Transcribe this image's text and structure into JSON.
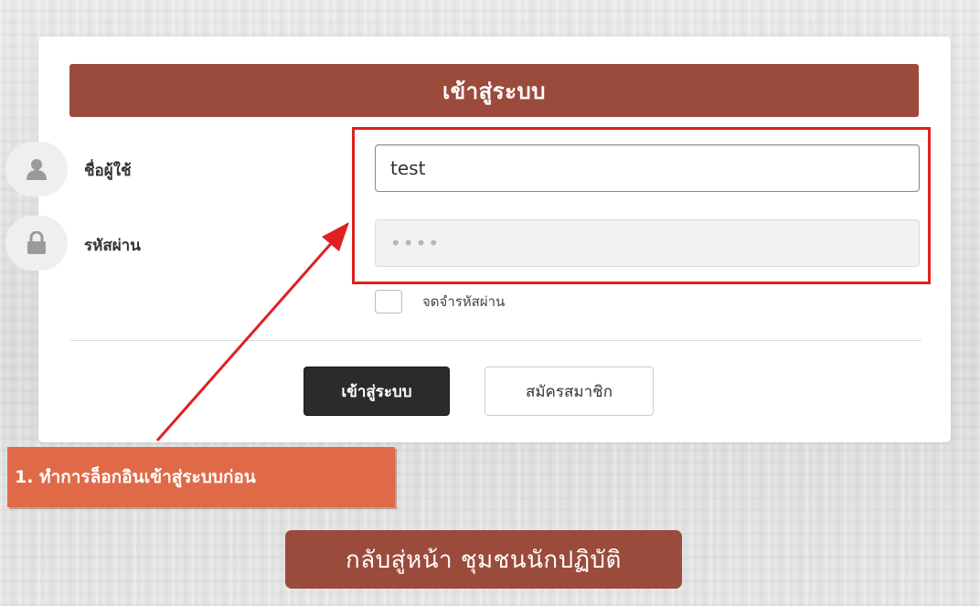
{
  "login_panel": {
    "title": "เข้าสู่ระบบ",
    "username": {
      "label": "ชื่อผู้ใช้",
      "icon": "user-icon",
      "value": "test"
    },
    "password": {
      "label": "รหัสผ่าน",
      "icon": "lock-icon",
      "masked_value": "••••"
    },
    "remember": {
      "label": "จดจำรหัสผ่าน",
      "checked": false
    },
    "buttons": {
      "login_label": "เข้าสู่ระบบ",
      "register_label": "สมัครสมาชิก"
    }
  },
  "annotation": {
    "text": "1. ทำการล็อกอินเข้าสู่ระบบก่อน",
    "highlight_color": "#e02020"
  },
  "back_button": {
    "label": "กลับสู่หน้า ชุมชนนักปฏิบัติ"
  },
  "colors": {
    "brand": "#9b4b3c",
    "annotation_bg": "#e06a48",
    "login_button": "#2b2b2b"
  }
}
